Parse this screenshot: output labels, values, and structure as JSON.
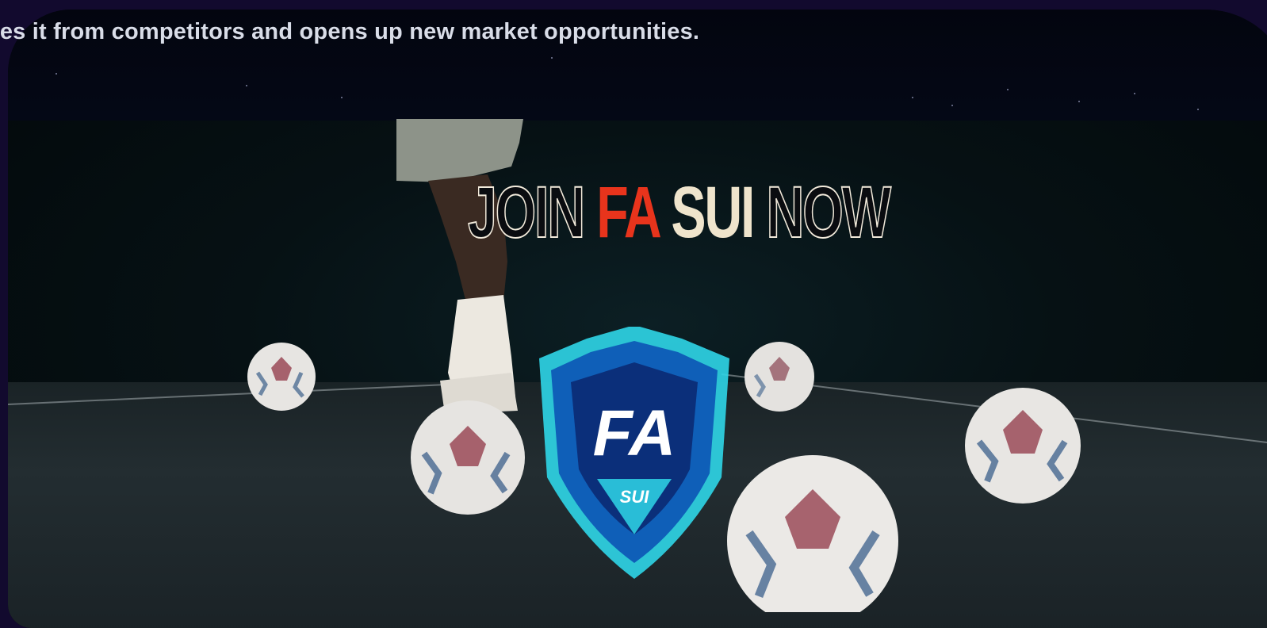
{
  "hero": {
    "tagline": "tes it from competitors and opens up new market opportunities.",
    "headline_parts": [
      "JOIN ",
      "FA",
      " SUI ",
      "NOW"
    ],
    "logo_main": "FA",
    "logo_sub": "SUI"
  },
  "colors": {
    "page_bg": "#120a2e",
    "accent_red": "#e8341c",
    "accent_cyan": "#2fd6e8",
    "text": "#d9dde8"
  }
}
